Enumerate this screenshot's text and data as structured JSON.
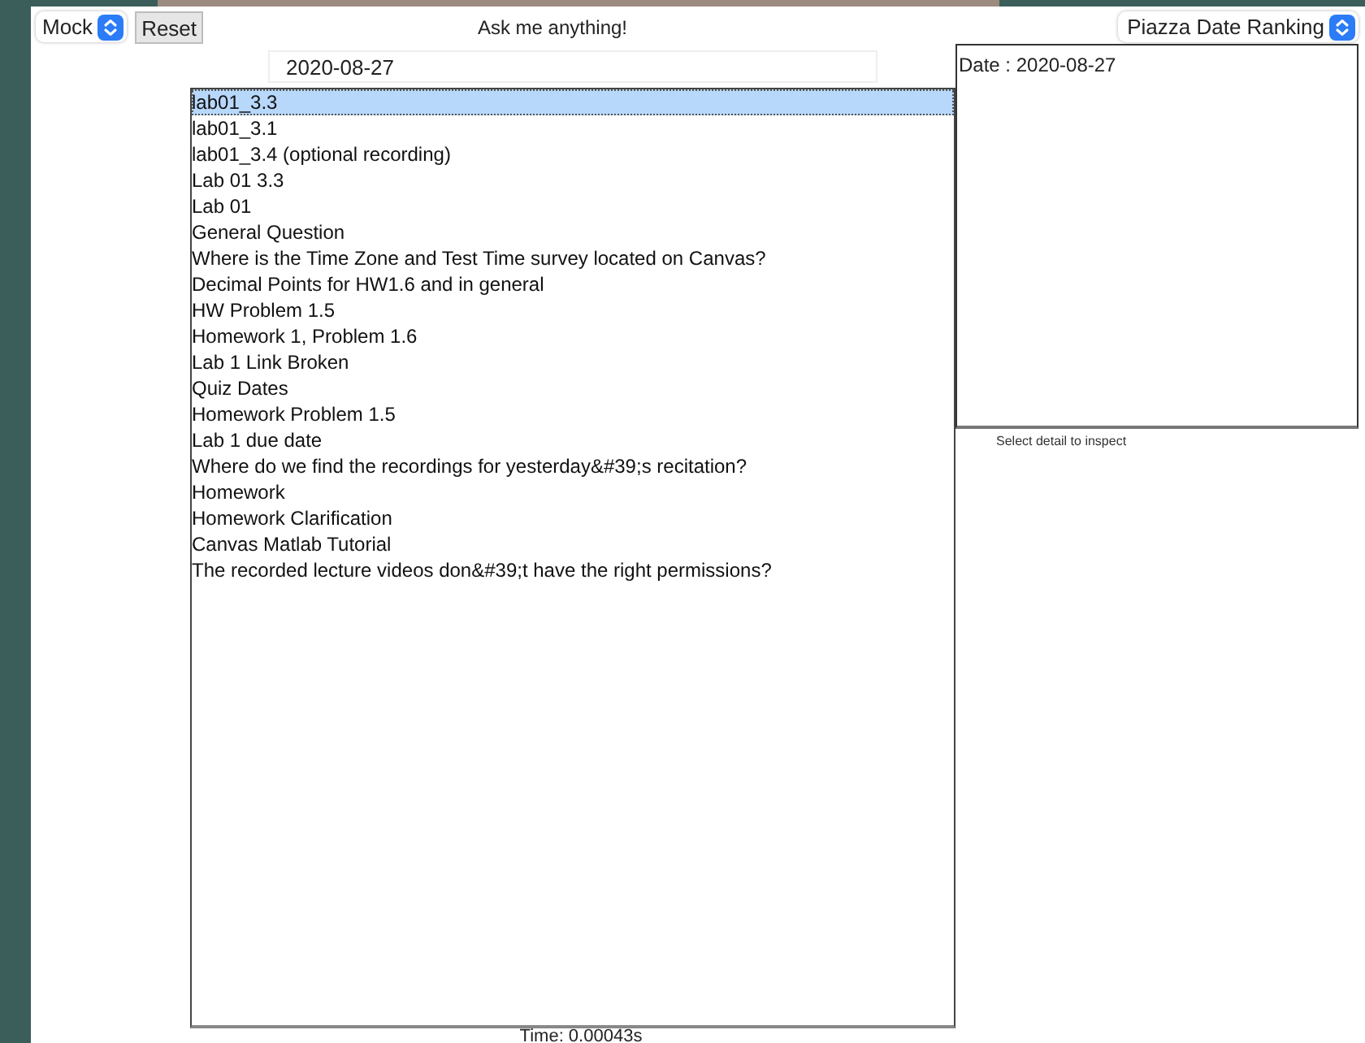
{
  "toolbar": {
    "mode_select": "Mock",
    "reset_button": "Reset",
    "title": "Ask me anything!",
    "ranking_select": "Piazza Date Ranking"
  },
  "date_field": {
    "value": "2020-08-27"
  },
  "posts": [
    {
      "label": "lab01_3.3",
      "selected": true
    },
    {
      "label": "lab01_3.1",
      "selected": false
    },
    {
      "label": "lab01_3.4 (optional recording)",
      "selected": false
    },
    {
      "label": "Lab 01 3.3",
      "selected": false
    },
    {
      "label": "Lab 01",
      "selected": false
    },
    {
      "label": "General Question",
      "selected": false
    },
    {
      "label": "Where is the Time Zone and Test Time survey located on Canvas?",
      "selected": false
    },
    {
      "label": "Decimal Points for HW1.6 and in general",
      "selected": false
    },
    {
      "label": "HW Problem 1.5",
      "selected": false
    },
    {
      "label": "Homework 1, Problem 1.6",
      "selected": false
    },
    {
      "label": "Lab 1 Link Broken",
      "selected": false
    },
    {
      "label": "Quiz Dates",
      "selected": false
    },
    {
      "label": "Homework Problem 1.5",
      "selected": false
    },
    {
      "label": "Lab 1 due date",
      "selected": false
    },
    {
      "label": "Where do we find the recordings for yesterday&#39;s recitation?",
      "selected": false
    },
    {
      "label": "Homework",
      "selected": false
    },
    {
      "label": "Homework Clarification",
      "selected": false
    },
    {
      "label": "Canvas Matlab Tutorial",
      "selected": false
    },
    {
      "label": "The recorded lecture videos don&#39;t have the right permissions?",
      "selected": false
    }
  ],
  "detail": {
    "text": "Date : 2020-08-27",
    "caption": "Select detail to inspect"
  },
  "status": {
    "time": "Time: 0.00043s"
  }
}
